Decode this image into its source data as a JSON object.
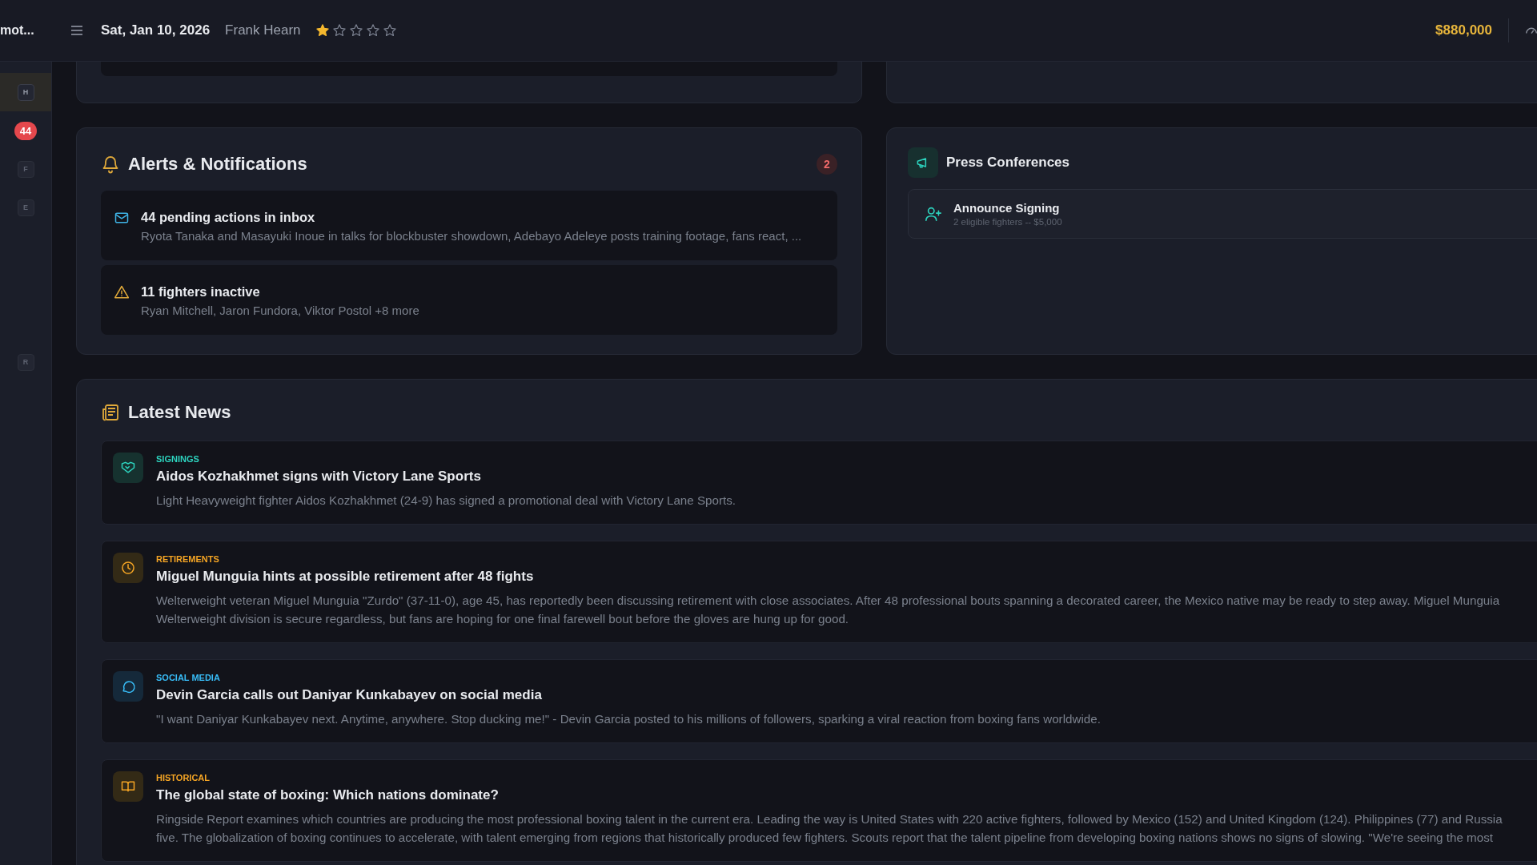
{
  "header": {
    "brand": "mot...",
    "date": "Sat, Jan 10, 2026",
    "manager": "Frank Hearn",
    "stars": 1,
    "balance": "$880,000"
  },
  "sidebar": {
    "items": [
      {
        "kind": "key",
        "label": "H",
        "selected": true
      },
      {
        "kind": "badge",
        "label": "44",
        "selected": false
      },
      {
        "kind": "key",
        "label": "F",
        "selected": false
      },
      {
        "kind": "key",
        "label": "E",
        "selected": false
      },
      {
        "kind": "spacer"
      },
      {
        "kind": "key",
        "label": "R",
        "selected": false
      }
    ]
  },
  "alerts": {
    "title": "Alerts & Notifications",
    "count": "2",
    "items": [
      {
        "kind": "mail",
        "title": "44 pending actions in inbox",
        "detail": "Ryota Tanaka and Masayuki Inoue in talks for blockbuster showdown, Adebayo Adeleye posts training footage, fans react, ..."
      },
      {
        "kind": "warning",
        "title": "11 fighters inactive",
        "detail": "Ryan Mitchell, Jaron Fundora, Viktor Postol +8 more"
      }
    ]
  },
  "press_conferences": {
    "title": "Press Conferences",
    "items": [
      {
        "kind": "signing",
        "title": "Announce Signing",
        "detail": "2 eligible fighters -- $5,000"
      }
    ]
  },
  "news": {
    "title": "Latest News",
    "items": [
      {
        "kind": "signings",
        "category": "SIGNINGS",
        "headline": "Aidos Kozhakhmet signs with Victory Lane Sports",
        "body": [
          "Light Heavyweight fighter Aidos Kozhakhmet (24-9) has signed a promotional deal with Victory Lane Sports."
        ]
      },
      {
        "kind": "retirements",
        "category": "RETIREMENTS",
        "headline": "Miguel Munguia hints at possible retirement after 48 fights",
        "body": [
          "Welterweight veteran Miguel Munguia \"Zurdo\" (37-11-0), age 45, has reportedly been discussing retirement with close associates. After 48 professional bouts spanning a decorated career, the Mexico native may be ready to step away. Miguel Munguia",
          "Welterweight division is secure regardless, but fans are hoping for one final farewell bout before the gloves are hung up for good."
        ]
      },
      {
        "kind": "social",
        "category": "SOCIAL MEDIA",
        "headline": "Devin Garcia calls out Daniyar Kunkabayev on social media",
        "body": [
          "\"I want Daniyar Kunkabayev next. Anytime, anywhere. Stop ducking me!\" - Devin Garcia posted to his millions of followers, sparking a viral reaction from boxing fans worldwide."
        ]
      },
      {
        "kind": "historical",
        "category": "HISTORICAL",
        "headline": "The global state of boxing: Which nations dominate?",
        "body": [
          "Ringside Report examines which countries are producing the most professional boxing talent in the current era. Leading the way is United States with 220 active fighters, followed by Mexico (152) and United Kingdom (124). Philippines (77) and Russia",
          "five. The globalization of boxing continues to accelerate, with talent emerging from regions that historically produced few fighters. Scouts report that the talent pipeline from developing boxing nations shows no signs of slowing. \"We're seeing the most"
        ]
      }
    ]
  }
}
